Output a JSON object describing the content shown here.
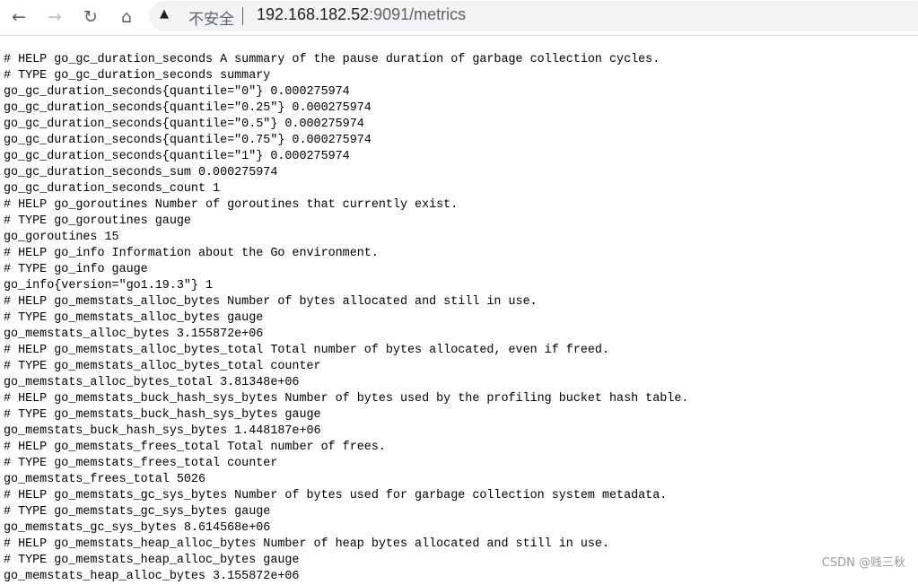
{
  "browser": {
    "back_icon": "arrow-left-icon",
    "forward_icon": "arrow-right-icon",
    "reload_icon": "reload-icon",
    "home_icon": "home-icon",
    "security_icon": "warning-triangle-icon",
    "security_label": "不安全",
    "url_host": "192.168.182.52",
    "url_rest": ":9091/metrics"
  },
  "lines": [
    "# HELP go_gc_duration_seconds A summary of the pause duration of garbage collection cycles.",
    "# TYPE go_gc_duration_seconds summary",
    "go_gc_duration_seconds{quantile=\"0\"} 0.000275974",
    "go_gc_duration_seconds{quantile=\"0.25\"} 0.000275974",
    "go_gc_duration_seconds{quantile=\"0.5\"} 0.000275974",
    "go_gc_duration_seconds{quantile=\"0.75\"} 0.000275974",
    "go_gc_duration_seconds{quantile=\"1\"} 0.000275974",
    "go_gc_duration_seconds_sum 0.000275974",
    "go_gc_duration_seconds_count 1",
    "# HELP go_goroutines Number of goroutines that currently exist.",
    "# TYPE go_goroutines gauge",
    "go_goroutines 15",
    "# HELP go_info Information about the Go environment.",
    "# TYPE go_info gauge",
    "go_info{version=\"go1.19.3\"} 1",
    "# HELP go_memstats_alloc_bytes Number of bytes allocated and still in use.",
    "# TYPE go_memstats_alloc_bytes gauge",
    "go_memstats_alloc_bytes 3.155872e+06",
    "# HELP go_memstats_alloc_bytes_total Total number of bytes allocated, even if freed.",
    "# TYPE go_memstats_alloc_bytes_total counter",
    "go_memstats_alloc_bytes_total 3.81348e+06",
    "# HELP go_memstats_buck_hash_sys_bytes Number of bytes used by the profiling bucket hash table.",
    "# TYPE go_memstats_buck_hash_sys_bytes gauge",
    "go_memstats_buck_hash_sys_bytes 1.448187e+06",
    "# HELP go_memstats_frees_total Total number of frees.",
    "# TYPE go_memstats_frees_total counter",
    "go_memstats_frees_total 5026",
    "# HELP go_memstats_gc_sys_bytes Number of bytes used for garbage collection system metadata.",
    "# TYPE go_memstats_gc_sys_bytes gauge",
    "go_memstats_gc_sys_bytes 8.614568e+06",
    "# HELP go_memstats_heap_alloc_bytes Number of heap bytes allocated and still in use.",
    "# TYPE go_memstats_heap_alloc_bytes gauge",
    "go_memstats_heap_alloc_bytes 3.155872e+06"
  ],
  "watermark": "CSDN @贱三秋"
}
